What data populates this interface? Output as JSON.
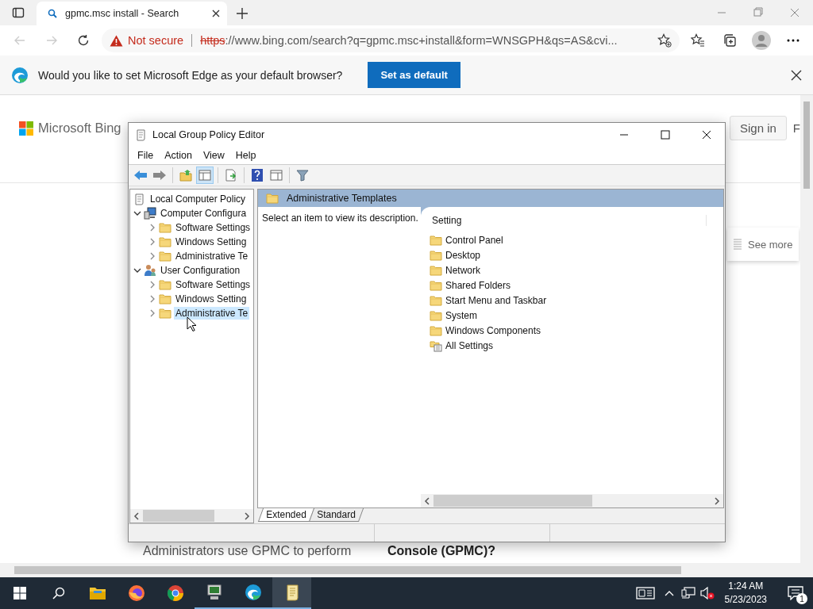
{
  "browser": {
    "tab": {
      "title": "gpmc.msc install - Search",
      "selected": true
    },
    "address": {
      "security": "Not secure",
      "scheme": "https",
      "rest": "://www.bing.com/search?q=gpmc.msc+install&form=WNSGPH&qs=AS&cvi..."
    },
    "infobar": {
      "message": "Would you like to set Microsoft Edge as your default browser?",
      "button": "Set as default"
    }
  },
  "page": {
    "logo": "Microsoft Bing",
    "sign_in": "Sign in",
    "cut_letter": "F",
    "see_more": "See more",
    "snippet": "Administrators use GPMC to perform",
    "result_title": "Console (GPMC)?"
  },
  "editor": {
    "title": "Local Group Policy Editor",
    "menu": [
      "File",
      "Action",
      "View",
      "Help"
    ],
    "tree": [
      {
        "label": "Local Computer Policy",
        "kind": "policy",
        "selected": false,
        "children": [
          {
            "label": "Computer Configura",
            "kind": "computer",
            "expanded": true,
            "selected": false,
            "children": [
              {
                "label": "Software Settings",
                "kind": "folder",
                "expanded": false,
                "selected": false
              },
              {
                "label": "Windows Setting",
                "kind": "folder",
                "expanded": false,
                "selected": false
              },
              {
                "label": "Administrative Te",
                "kind": "folder",
                "expanded": false,
                "selected": false
              }
            ]
          },
          {
            "label": "User Configuration",
            "kind": "user",
            "expanded": true,
            "selected": false,
            "children": [
              {
                "label": "Software Settings",
                "kind": "folder",
                "expanded": false,
                "selected": false
              },
              {
                "label": "Windows Setting",
                "kind": "folder",
                "expanded": false,
                "selected": false
              },
              {
                "label": "Administrative Te",
                "kind": "folder",
                "expanded": false,
                "selected": true
              }
            ]
          }
        ]
      }
    ],
    "header": "Administrative Templates",
    "description": "Select an item to view its description.",
    "column": "Setting",
    "items": [
      {
        "label": "Control Panel",
        "kind": "folder"
      },
      {
        "label": "Desktop",
        "kind": "folder"
      },
      {
        "label": "Network",
        "kind": "folder"
      },
      {
        "label": "Shared Folders",
        "kind": "folder"
      },
      {
        "label": "Start Menu and Taskbar",
        "kind": "folder"
      },
      {
        "label": "System",
        "kind": "folder"
      },
      {
        "label": "Windows Components",
        "kind": "folder"
      },
      {
        "label": "All Settings",
        "kind": "settings"
      }
    ],
    "tabs": [
      {
        "label": "Extended",
        "selected": true
      },
      {
        "label": "Standard",
        "selected": false
      }
    ]
  },
  "taskbar": {
    "time": "1:24 AM",
    "date": "5/23/2023",
    "notifications": "1"
  }
}
